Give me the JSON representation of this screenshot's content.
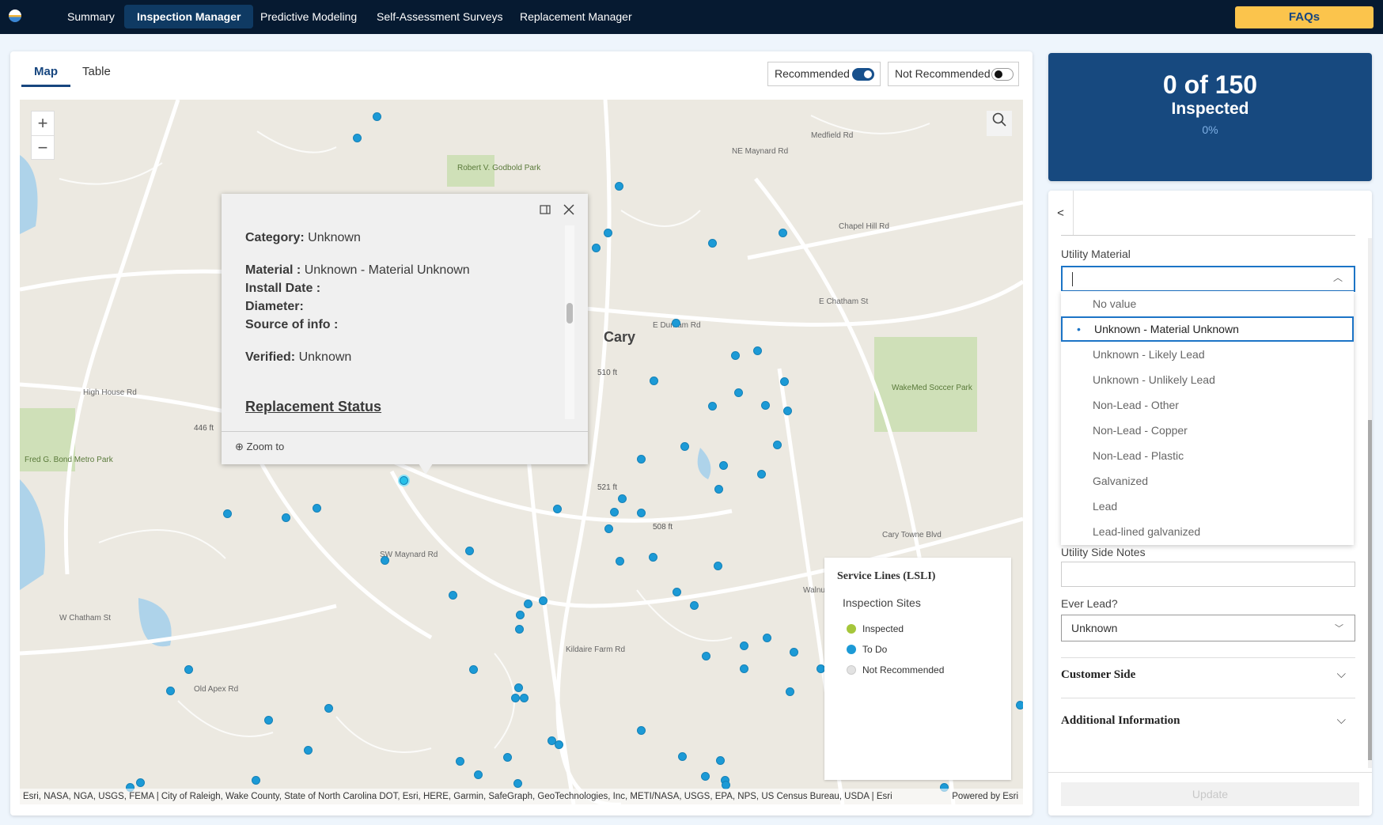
{
  "nav": {
    "tabs": [
      "Summary",
      "Inspection Manager",
      "Predictive Modeling",
      "Self-Assessment Surveys",
      "Replacement Manager"
    ],
    "active": "Inspection Manager",
    "faq_label": "FAQs"
  },
  "view_tabs": {
    "map": "Map",
    "table": "Table",
    "active": "Map"
  },
  "toggles": {
    "recommended": {
      "label": "Recommended",
      "on": true
    },
    "not_recommended": {
      "label": "Not Recommended",
      "on": false
    }
  },
  "map": {
    "place_labels": [
      "Cary",
      "Robert V. Godbold Park",
      "Fred G. Bond Metro Park",
      "WakeMed Soccer Park",
      "NE Maynard Rd",
      "Chapel Hill Rd",
      "E Chatham St",
      "SW Maynard Rd",
      "Cary Towne Blvd",
      "Old Apex Rd",
      "W Chatham St",
      "Medfield Rd",
      "Kildaire Farm Rd",
      "Walnut St",
      "E Durham Rd",
      "High House Rd",
      "510 ft",
      "521 ft",
      "446 ft",
      "508 ft"
    ],
    "popup": {
      "category_label": "Category:",
      "category": "Unknown",
      "material_label": "Material :",
      "material": "Unknown - Material Unknown",
      "install_label": "Install Date :",
      "diameter_label": "Diameter:",
      "source_label": "Source of info :",
      "verified_label": "Verified:",
      "verified": "Unknown",
      "section": "Replacement Status",
      "zoom_to": "Zoom to"
    },
    "legend": {
      "title": "Service Lines (LSLI)",
      "subtitle": "Inspection Sites",
      "items": [
        {
          "label": "Inspected",
          "color": "#a5c63b"
        },
        {
          "label": "To Do",
          "color": "#1c9ad6"
        },
        {
          "label": "Not Recommended",
          "color": "#e2e2e2"
        }
      ]
    },
    "attribution": "Esri, NASA, NGA, USGS, FEMA | City of Raleigh, Wake County, State of North Carolina DOT, Esri, HERE, Garmin, SafeGraph, GeoTechnologies, Inc, METI/NASA, USGS, EPA, NPS, US Census Bureau, USDA | Esri",
    "powered_by": "Powered by Esri"
  },
  "stats": {
    "count": "0 of 150",
    "label": "Inspected",
    "percent": "0%",
    "progress": 0
  },
  "form": {
    "back": "<",
    "utility_material_label": "Utility Material",
    "utility_material_value": "",
    "options": [
      "No value",
      "Unknown - Material Unknown",
      "Unknown - Likely Lead",
      "Unknown - Unlikely Lead",
      "Non-Lead - Other",
      "Non-Lead - Copper",
      "Non-Lead - Plastic",
      "Galvanized",
      "Lead",
      "Lead-lined galvanized"
    ],
    "selected_option": "Unknown - Material Unknown",
    "notes_label": "Utility Side Notes",
    "notes_value": "",
    "ever_lead_label": "Ever Lead?",
    "ever_lead_value": "Unknown",
    "customer_side": "Customer Side",
    "additional_info": "Additional Information",
    "update": "Update"
  }
}
